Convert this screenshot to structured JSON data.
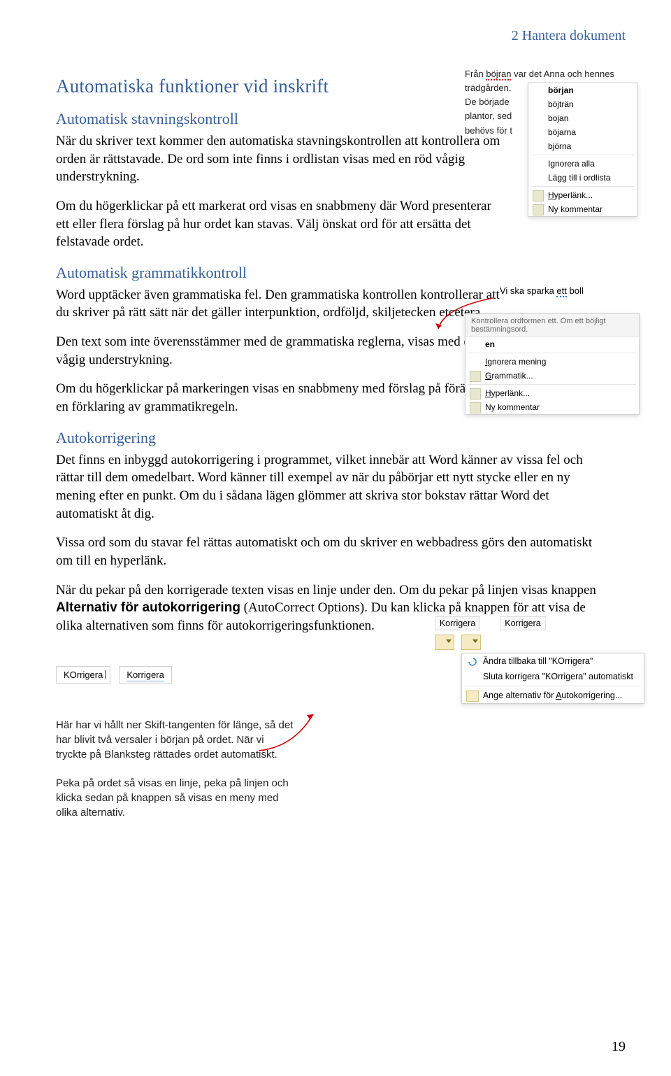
{
  "header": {
    "running": "2  Hantera dokument"
  },
  "section": {
    "title": "Automatiska funktioner vid inskrift",
    "spell": {
      "heading": "Automatisk stavningskontroll",
      "p1": "När du skriver text kommer den automatiska stavningskontrollen att kontrollera om orden är rättstavade. De ord som inte finns i ordlistan visas med en röd vågig understrykning.",
      "p2": "Om du högerklickar på ett markerat ord visas en snabbmeny där Word presenterar ett eller flera förslag på hur ordet kan stavas. Välj önskat ord för att ersätta det felstavade ordet."
    },
    "grammar": {
      "heading": "Automatisk grammatikkontroll",
      "p1": "Word upptäcker även grammatiska fel. Den grammatiska kontrollen kontrollerar att du skriver på rätt sätt när det gäller interpunktion, ordföljd, skiljetecken etcetera.",
      "p2": "Den text som inte överensstämmer med de grammatiska reglerna, visas med en blå vågig understrykning.",
      "p3": "Om du högerklickar på markeringen visas en snabbmeny med förslag på förändring tillsammans med en förklaring av grammatikregeln."
    },
    "autocorr": {
      "heading": "Autokorrigering",
      "p1": "Det finns en inbyggd autokorrigering i programmet, vilket innebär att Word känner av vissa fel och rättar till dem omedelbart. Word känner till exempel av när du påbörjar ett nytt stycke eller en ny mening efter en punkt. Om du i sådana lägen glömmer att skriva stor bokstav rättar Word det automatiskt åt dig.",
      "p2": "Vissa ord som du stavar fel rättas automatiskt och om du skriver en webbadress görs den automatiskt om till en hyperlänk.",
      "p3a": "När du pekar på den korrigerade texten visas en linje under den. Om du pekar på linjen visas knappen ",
      "p3bold": "Alternativ för autokorrigering",
      "p3b": " (AutoCorrect Options). Du kan klicka på knappen för att visa de olika alternativen som finns för autokorrigeringsfunktionen."
    },
    "captions": {
      "c1": "Här har vi hållt ner Skift-tangenten för länge, så det har blivit två versaler i början på ordet. När vi tryckte på Blanksteg rättades ordet automatiskt.",
      "c2": "Peka på ordet så visas en linje, peka på linjen och klicka sedan på knappen så visas en meny med olika alternativ."
    }
  },
  "spell_menu": {
    "context_pre": "Från ",
    "context_word": "böjran",
    "context_post": " var det Anna och hennes",
    "lines": [
      "trädgården.",
      "De började",
      "plantor, sed",
      "behövs för t"
    ],
    "suggestions": [
      "början",
      "böjträn",
      "bojan",
      "böjarna",
      "björna"
    ],
    "ignore_all": "Ignorera alla",
    "add_dict": "Lägg till i ordlista",
    "hyper": "Hyperlänk...",
    "comment": "Ny kommentar"
  },
  "gram_menu": {
    "sentence_pre": "Vi ska sparka ",
    "sentence_word": "ett",
    "sentence_post": " boll",
    "header": "Kontrollera ordformen ett. Om ett böjligt bestämningsord.",
    "suggestion": "en",
    "ignore": "Ignorera mening",
    "grammar": "Grammatik...",
    "hyper": "Hyperlänk...",
    "comment": "Ny kommentar"
  },
  "autocorr_ex": {
    "before": "KOrrigera",
    "after": "Korrigera",
    "label": "Korrigera",
    "menu_top": "Korrigera",
    "m1": "Ändra tillbaka till \"KOrrigera\"",
    "m2": "Sluta korrigera \"KOrrigera\" automatiskt",
    "m3": "Ange alternativ för Autokorrigering..."
  },
  "page": "19"
}
